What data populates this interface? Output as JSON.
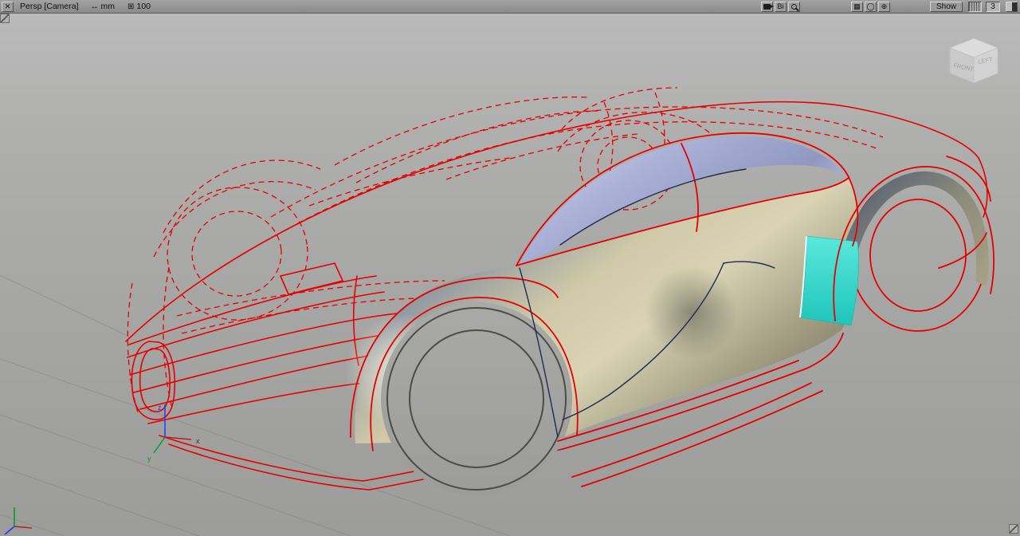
{
  "toolbar": {
    "close_glyph": "✕",
    "view_label": "Persp [Camera]",
    "units_icon": "↔",
    "units_label": "mm",
    "grid_icon": "⊞",
    "grid_value": "100",
    "bi_label": "Bi",
    "plane_icon": "▦",
    "circle_icon": "◯",
    "move_icon": "⊕",
    "show_button": "Show",
    "layer_value": "3"
  },
  "viewcube": {
    "front": "FRONT",
    "left": "LEFT"
  },
  "pivot_axes": {
    "x": "x",
    "y": "y",
    "z": "z"
  },
  "colors": {
    "wireframe_red": "#e60000",
    "feature_navy": "#202a52",
    "surface_teal": "#2fd8cc",
    "glass_lavender": "#a8aed4",
    "body_khaki": "#cfc9a8"
  }
}
